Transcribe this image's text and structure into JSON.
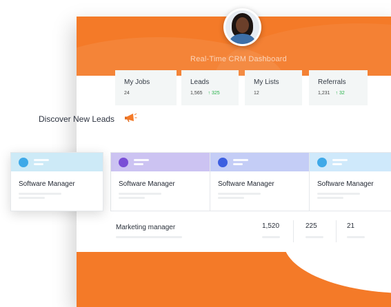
{
  "header": {
    "title": "Real-Time CRM Dashboard",
    "accent_color": "#f47a28"
  },
  "avatar": {
    "icon": "user-avatar"
  },
  "stats": [
    {
      "label": "My Jobs",
      "value": "24",
      "delta": ""
    },
    {
      "label": "Leads",
      "value": "1,565",
      "delta": "↑ 325"
    },
    {
      "label": "My Lists",
      "value": "12",
      "delta": ""
    },
    {
      "label": "Referrals",
      "value": "1,231",
      "delta": "↑ 32"
    }
  ],
  "discover": {
    "heading": "Discover New Leads",
    "icon": "megaphone-icon"
  },
  "leads": [
    {
      "title": "Software Manager",
      "band_color": "#cdeaf7",
      "dot_color": "#3fa9e8"
    },
    {
      "title": "Software Manager",
      "band_color": "#ccc3f2",
      "dot_color": "#7a4fd6"
    },
    {
      "title": "Software Manager",
      "band_color": "#c4cdf6",
      "dot_color": "#3d5fe0"
    },
    {
      "title": "Software Manager",
      "band_color": "#cfe9fb",
      "dot_color": "#3fa9e8"
    }
  ],
  "marketing": {
    "label": "Marketing manager",
    "values": [
      "1,520",
      "225",
      "21"
    ]
  }
}
